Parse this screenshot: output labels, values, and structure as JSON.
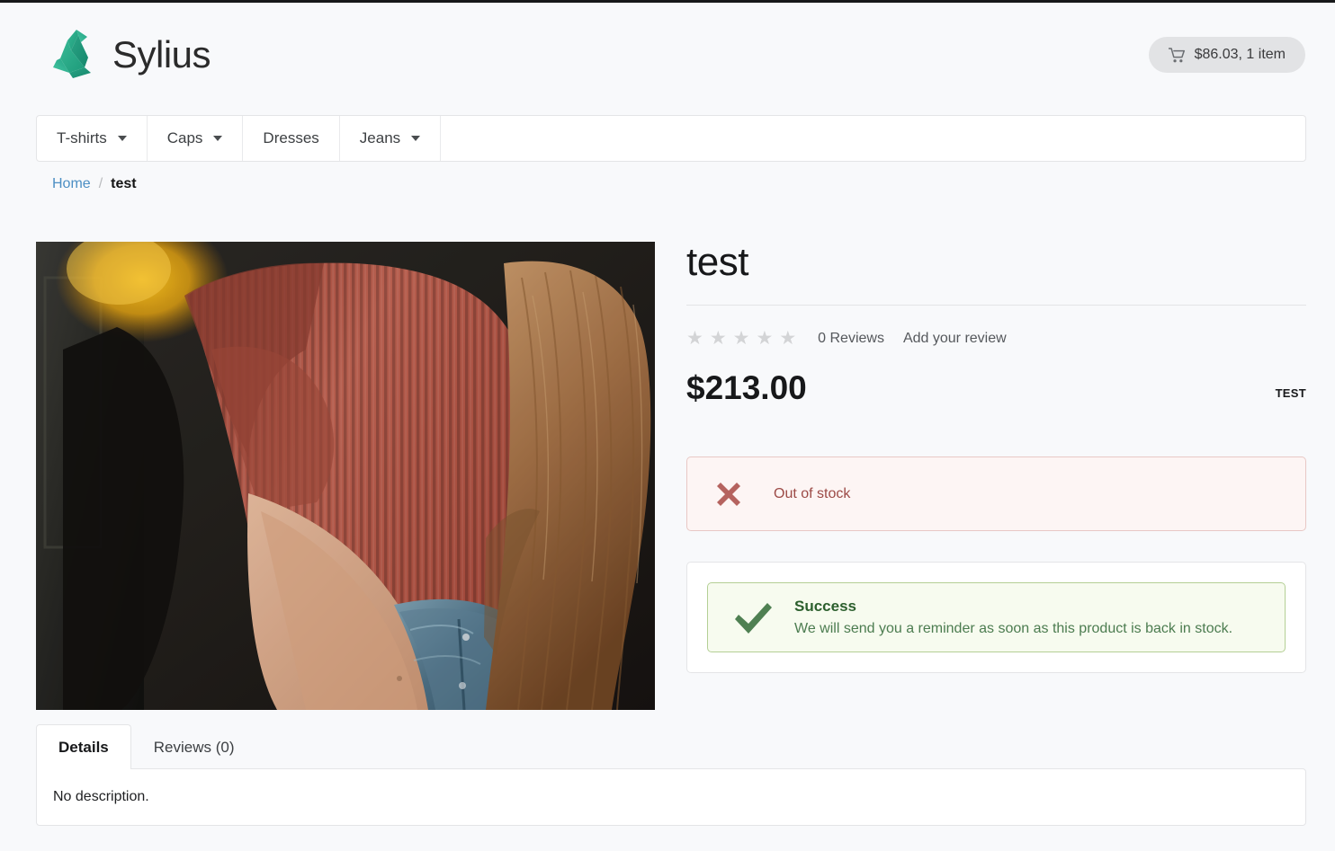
{
  "site": {
    "brand_name": "Sylius",
    "logo_icon": "sylius-swan-logo",
    "accent_color": "#2fa886"
  },
  "header": {
    "cart": {
      "icon": "shopping-cart-icon",
      "label": "$86.03, 1 item",
      "total": "$86.03",
      "item_count": "1 item"
    }
  },
  "nav": {
    "items": [
      {
        "label": "T-shirts",
        "has_dropdown": true
      },
      {
        "label": "Caps",
        "has_dropdown": true
      },
      {
        "label": "Dresses",
        "has_dropdown": false
      },
      {
        "label": "Jeans",
        "has_dropdown": true
      }
    ]
  },
  "breadcrumb": {
    "home_label": "Home",
    "separator": "/",
    "current_label": "test"
  },
  "product": {
    "title": "test",
    "image_alt": "test",
    "reviews": {
      "star_count": 5,
      "filled_stars": 0,
      "star_glyph": "★",
      "count_label": "0 Reviews",
      "add_review_label": "Add your review"
    },
    "price": "$213.00",
    "brand_tag": "TEST",
    "out_of_stock": {
      "icon": "cross-icon",
      "label": "Out of stock",
      "text_color": "#9c4a46",
      "background_color": "#fdf5f4",
      "border_color": "#e8c8c5"
    },
    "success_notice": {
      "icon": "check-icon",
      "title": "Success",
      "message": "We will send you a reminder as soon as this product is back in stock.",
      "text_color": "#4c7c50",
      "background_color": "#f7fbef",
      "border_color": "#b4cf95"
    }
  },
  "tabs": {
    "items": [
      {
        "label": "Details",
        "active": true
      },
      {
        "label": "Reviews (0)",
        "active": false
      }
    ],
    "panel_text": "No description."
  }
}
